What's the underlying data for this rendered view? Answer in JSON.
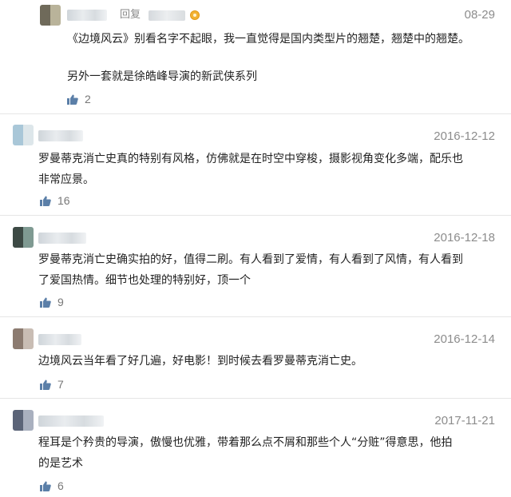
{
  "comments": [
    {
      "date": "08-29",
      "reply_label": "回复",
      "text": "《边境风云》别看名字不起眼，我一直觉得是国内类型片的翘楚，翘楚中的翘楚。",
      "text2": "另外一套就是徐皓峰导演的新武侠系列",
      "likes": "2"
    },
    {
      "date": "2016-12-12",
      "text": "罗曼蒂克消亡史真的特别有风格，仿佛就是在时空中穿梭，摄影视角变化多端，配乐也\n非常应景。",
      "likes": "16"
    },
    {
      "date": "2016-12-18",
      "text": "罗曼蒂克消亡史确实拍的好，值得二刷。有人看到了爱情，有人看到了风情，有人看到\n了爱国热情。细节也处理的特别好，顶一个",
      "likes": "9"
    },
    {
      "date": "2016-12-14",
      "text": "边境风云当年看了好几遍，好电影！到时候去看罗曼蒂克消亡史。",
      "likes": "7"
    },
    {
      "date": "2017-11-21",
      "text": "程耳是个矜贵的导演，傲慢也优雅，带着那么点不屑和那些个人“分赃”得意思，他拍\n的是艺术",
      "likes": "6"
    }
  ],
  "colors": {
    "text": "#222222",
    "meta": "#8c8c8c",
    "like_icon": "#5b7fa8"
  },
  "icons": {
    "like": "thumbs-up-icon",
    "badge": "vip-badge-icon"
  }
}
